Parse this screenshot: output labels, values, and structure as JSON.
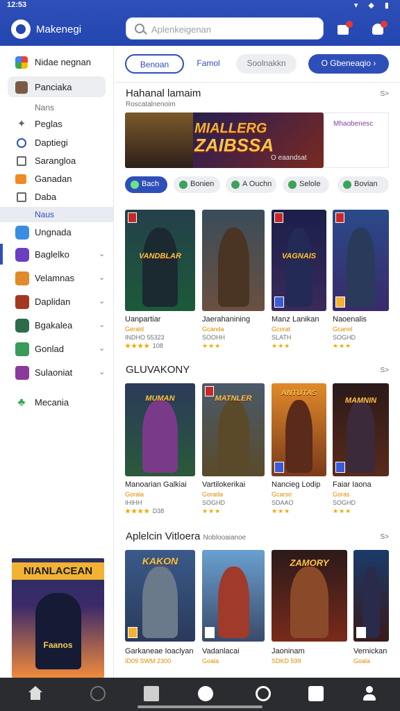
{
  "status": {
    "time": "12:53",
    "icons": "▾ ◆ ▮"
  },
  "app": {
    "title": "Makenegi",
    "search_placeholder": "Aplenkeigenan"
  },
  "sidebar": {
    "account": "Nidae negnan",
    "selected": "Panciaka",
    "section_nans": "Nans",
    "items_top": [
      "Peglas",
      "Daptiegi",
      "Sarangloa",
      "Ganadan",
      "Daba"
    ],
    "section_news": "Naus",
    "games": [
      "Ungnada",
      "Baglelko",
      "Velamnas",
      "Daplidan",
      "Bgakalea",
      "Gonlad",
      "Sulaoniat"
    ],
    "last": "Mecania",
    "promo_title": "NIANLACEAN",
    "promo_tag": "Faanos"
  },
  "chips": [
    "Benoan",
    "Famol",
    "Soolnakkn",
    "O Gbeneaqio"
  ],
  "featured": {
    "title": "Hahanal lamaim",
    "subtitle": "Roscatalnenoim",
    "see_all": "S>",
    "banner_line1": "MIALLERG",
    "banner_line2": "ZAIBSSA",
    "banner_sub": "O eaandsat",
    "side_label": "Mhaobenesc"
  },
  "filters": [
    "Bach",
    "Bonien",
    "A Ouchn",
    "Selole",
    "Bovian"
  ],
  "row1": [
    {
      "name": "Uanpartiar",
      "meta1": "Gerald",
      "meta2": "INDHO 55323",
      "stars": "★★★★",
      "rating": "108",
      "logo": "VANDBLAR"
    },
    {
      "name": "Jaerahanining",
      "meta1": "Gcanda",
      "meta2": "SOOHH",
      "stars": "★★★",
      "rating": "",
      "logo": ""
    },
    {
      "name": "Manz Lanikan",
      "meta1": "Gcorat",
      "meta2": "SLATH",
      "stars": "★★★",
      "rating": "",
      "logo": "VAGNAIS"
    },
    {
      "name": "Naoenalis",
      "meta1": "Gcanol",
      "meta2": "SOGHD",
      "stars": "★★★",
      "rating": "",
      "logo": ""
    }
  ],
  "section2": {
    "title": "GLUVAKONY",
    "see_all": "S>"
  },
  "row2": [
    {
      "name": "Manoarian Galkiai",
      "meta1": "Gorala",
      "meta2": "IHIHH",
      "stars": "★★★★",
      "rating": "D38",
      "logo": "MUMAN"
    },
    {
      "name": "Vartilokerikai",
      "meta1": "Gorada",
      "meta2": "SOGHD",
      "stars": "★★★",
      "rating": "",
      "logo": "MATNLER"
    },
    {
      "name": "Nancieg Lodip",
      "meta1": "Gcarso",
      "meta2": "SDAAO",
      "stars": "★★★",
      "rating": "",
      "logo": "ANTUTAS"
    },
    {
      "name": "Faiar Iaona",
      "meta1": "Goras",
      "meta2": "SOGHD",
      "stars": "★★★",
      "rating": "",
      "logo": "MAMNIN"
    }
  ],
  "section3": {
    "title": "Aplelcin Vitloera",
    "subtitle": "Noblooaianoe",
    "see_all": "S>"
  },
  "row3": [
    {
      "name": "Garkaneae Ioaclyan",
      "meta1": "ID09",
      "meta2": "SWM",
      "stars": "",
      "rating": "2300",
      "logo": "KAKON"
    },
    {
      "name": "Vadanlacai",
      "meta1": "Goala",
      "meta2": "",
      "stars": "",
      "rating": "",
      "logo": ""
    },
    {
      "name": "Jaoninam",
      "meta1": "SDKD",
      "meta2": "",
      "stars": "",
      "rating": "599",
      "logo": "ZAMORY"
    },
    {
      "name": "Vernickan",
      "meta1": "Goala",
      "meta2": "",
      "stars": "",
      "rating": "",
      "logo": ""
    }
  ],
  "nav": [
    "home",
    "games",
    "apps",
    "movies",
    "books",
    "kids",
    "profile"
  ]
}
